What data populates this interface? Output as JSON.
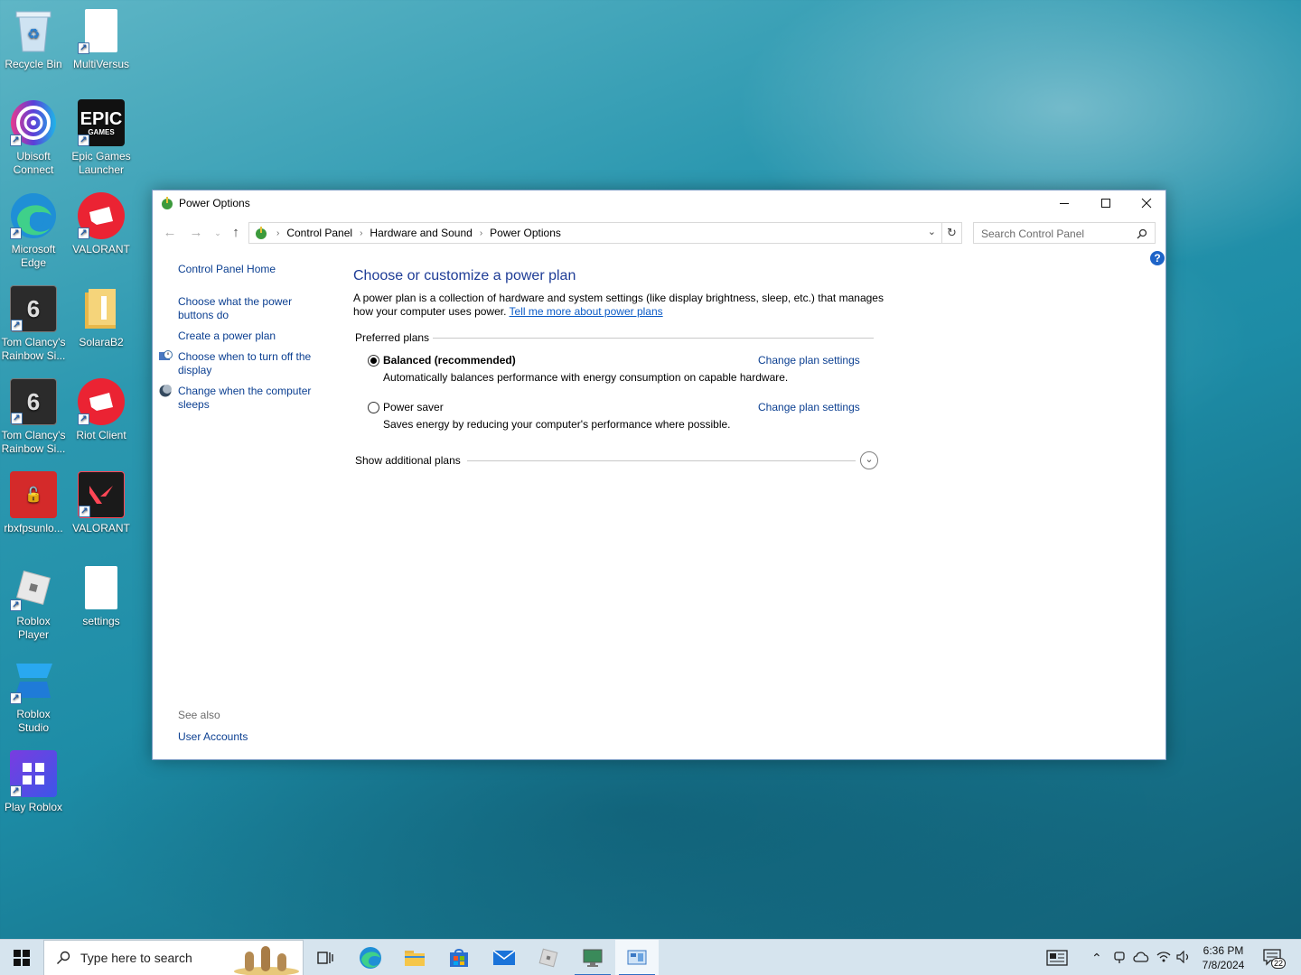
{
  "desktop": {
    "icons": [
      {
        "label": "Recycle Bin"
      },
      {
        "label": "MultiVersus"
      },
      {
        "label": "Ubisoft Connect"
      },
      {
        "label": "Epic Games Launcher"
      },
      {
        "label": "Microsoft Edge"
      },
      {
        "label": "VALORANT"
      },
      {
        "label": "Tom Clancy's Rainbow Si..."
      },
      {
        "label": "SolaraB2"
      },
      {
        "label": "Tom Clancy's Rainbow Si..."
      },
      {
        "label": "Riot Client"
      },
      {
        "label": "rbxfpsunlo..."
      },
      {
        "label": "VALORANT"
      },
      {
        "label": "Roblox Player"
      },
      {
        "label": "settings"
      },
      {
        "label": "Roblox Studio"
      },
      {
        "label": "Play Roblox"
      }
    ],
    "epic_logo_text": "EPIC",
    "epic_logo_sub": "GAMES"
  },
  "window": {
    "title": "Power Options",
    "address": {
      "segments": [
        "Control Panel",
        "Hardware and Sound",
        "Power Options"
      ]
    },
    "search_placeholder": "Search Control Panel",
    "help_label": "?",
    "left_pane": {
      "home": "Control Panel Home",
      "links": [
        "Choose what the power buttons do",
        "Create a power plan",
        "Choose when to turn off the display",
        "Change when the computer sleeps"
      ],
      "see_also": "See also",
      "see_also_links": [
        "User Accounts"
      ]
    },
    "main": {
      "heading": "Choose or customize a power plan",
      "intro": "A power plan is a collection of hardware and system settings (like display brightness, sleep, etc.) that manages how your computer uses power.",
      "intro_link": "Tell me more about power plans",
      "preferred_plans": "Preferred plans",
      "plans": [
        {
          "name": "Balanced (recommended)",
          "selected": true,
          "description": "Automatically balances performance with energy consumption on capable hardware.",
          "change": "Change plan settings"
        },
        {
          "name": "Power saver",
          "selected": false,
          "description": "Saves energy by reducing your computer's performance where possible.",
          "change": "Change plan settings"
        }
      ],
      "show_additional": "Show additional plans"
    }
  },
  "taskbar": {
    "search_placeholder": "Type here to search",
    "time": "6:36 PM",
    "date": "7/8/2024",
    "notification_count": "22"
  },
  "colors": {
    "link": "#0b3f91",
    "heading": "#1e3c96",
    "taskbar": "#d6e4ee"
  }
}
